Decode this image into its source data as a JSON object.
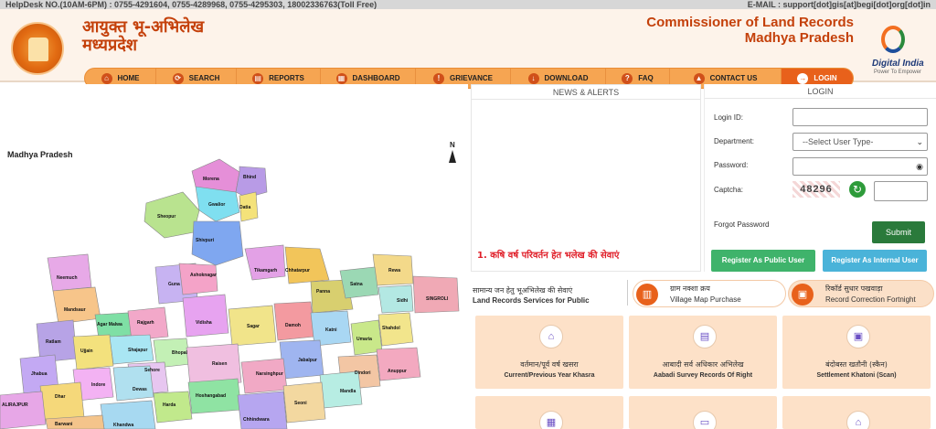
{
  "topbar": {
    "helpdesk": "HelpDesk NO.(10AM-6PM) : 0755-4291604, 0755-4289968, 0755-4295303, 18002336763(Toll Free)",
    "email": "E-MAIL : support[dot]gis[at]begi[dot]org[dot]in"
  },
  "header": {
    "hindi_line1": "आयुक्त भू-अभिलेख",
    "hindi_line2": "मध्यप्रदेश",
    "eng_line1": "Commissioner of Land Records",
    "eng_line2": "Madhya Pradesh",
    "digital_india": "Digital India",
    "digital_india_tagline": "Power To Empower"
  },
  "nav": [
    {
      "label": "HOME",
      "icon": "home-icon"
    },
    {
      "label": "SEARCH",
      "icon": "search-icon"
    },
    {
      "label": "REPORTS",
      "icon": "report-icon"
    },
    {
      "label": "DASHBOARD",
      "icon": "dashboard-icon"
    },
    {
      "label": "GRIEVANCE",
      "icon": "grievance-icon"
    },
    {
      "label": "DOWNLOAD",
      "icon": "download-icon"
    },
    {
      "label": "FAQ",
      "icon": "faq-icon"
    },
    {
      "label": "CONTACT US",
      "icon": "contact-icon"
    },
    {
      "label": "LOGIN",
      "icon": "login-icon",
      "active": true
    }
  ],
  "map": {
    "title": "Madhya Pradesh",
    "north": "N",
    "districts": [
      "Morena",
      "Bhind",
      "Gwalior",
      "Datia",
      "Sheopur",
      "Shivpuri",
      "Tikamgarh",
      "Chhatarpur",
      "Panna",
      "Rewa",
      "Satna",
      "Sidhi",
      "SINGROLI",
      "Neemuch",
      "Guna",
      "Ashoknagar",
      "Mandsaur",
      "Vidisha",
      "Sagar",
      "Damoh",
      "Katni",
      "Umaria",
      "Shahdol",
      "Ratlam",
      "Agar Malwa",
      "Rajgarh",
      "Ujjain",
      "Shajapur",
      "Bhopal",
      "Sehore",
      "Raisen",
      "Jabalpur",
      "Dindori",
      "Anuppur",
      "Jhabua",
      "Indore",
      "Dewas",
      "Narsinghpur",
      "Mandla",
      "Dhar",
      "Harda",
      "Hoshangabad",
      "Chhindwara",
      "Seoni",
      "ALIRAJPUR",
      "Khandwa",
      "Barwani"
    ]
  },
  "news": {
    "header": "NEWS & ALERTS",
    "item": "1. कषि वर्ष परिवर्तन हेत भलेख की सेवाएं"
  },
  "login": {
    "header": "LOGIN",
    "login_id_label": "Login ID:",
    "department_label": "Department:",
    "department_selected": "--Select User Type-",
    "password_label": "Password:",
    "captcha_label": "Captcha:",
    "captcha_value": "48296",
    "forgot": "Forgot Password",
    "submit": "Submit",
    "register_public": "Register As Public User",
    "register_internal": "Register As Internal User"
  },
  "services": {
    "hindi": "सामान्य जन हेतु भूअभिलेख की सेवाएं",
    "english": "Land Records Services for Public",
    "pills": [
      {
        "hindi": "ग्राम नक्शा क्रय",
        "english": "Village Map Purchase",
        "icon": "map-icon"
      },
      {
        "hindi": "रिकॉर्ड सुधार पखवाड़ा",
        "english": "Record Correction Fortnight",
        "icon": "record-icon",
        "active": true
      }
    ],
    "tiles": [
      {
        "hindi": "वर्तमान/पूर्व वर्ष खसरा",
        "english": "Current/Previous Year Khasra",
        "icon": "khasra-icon"
      },
      {
        "hindi": "आबादी सर्व अधिकार अभिलेख",
        "english": "Aabadi Survey Records Of Right",
        "icon": "aabadi-icon"
      },
      {
        "hindi": "बंदोबस्त खतौनी (स्कैन)",
        "english": "Settlement Khatoni (Scan)",
        "icon": "khatoni-icon"
      },
      {
        "hindi": "",
        "english": "",
        "icon": "document-icon"
      },
      {
        "hindi": "",
        "english": "",
        "icon": "folder-icon"
      },
      {
        "hindi": "",
        "english": "",
        "icon": "home-record-icon"
      }
    ]
  },
  "colors": {
    "accent": "#e8611b",
    "nav_bg": "#f6a552",
    "title_red": "#c4400a",
    "tile_bg": "#fde1c8",
    "submit_green": "#2a7a3b"
  }
}
